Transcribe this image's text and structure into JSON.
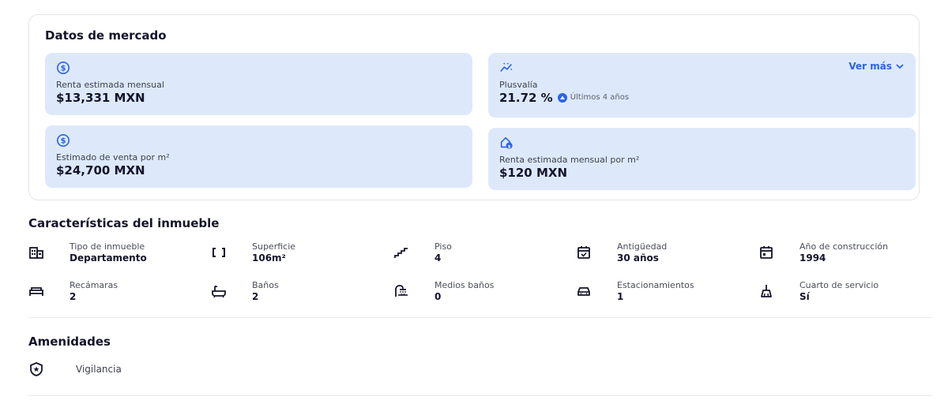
{
  "market": {
    "title": "Datos de mercado",
    "see_more": "Ver más",
    "tiles": [
      {
        "icon": "dollar-circle-icon",
        "label": "Renta estimada mensual",
        "value": "$13,331 MXN"
      },
      {
        "icon": "trend-icon",
        "label": "Plusvalía",
        "value": "21.72 %",
        "note": "Últimos 4 años"
      },
      {
        "icon": "dollar-circle-icon",
        "label": "Estimado de venta por m²",
        "value": "$24,700 MXN"
      },
      {
        "icon": "house-dollar-icon",
        "label": "Renta estimada mensual por m²",
        "value": "$120 MXN"
      }
    ]
  },
  "features": {
    "title": "Características del inmueble",
    "items": [
      {
        "icon": "building-icon",
        "label": "Tipo de inmueble",
        "value": "Departamento"
      },
      {
        "icon": "area-icon",
        "label": "Superficie",
        "value": "106m²"
      },
      {
        "icon": "stairs-icon",
        "label": "Piso",
        "value": "4"
      },
      {
        "icon": "calendar-check-icon",
        "label": "Antigüedad",
        "value": "30 años"
      },
      {
        "icon": "calendar-icon",
        "label": "Año de construcción",
        "value": "1994"
      },
      {
        "icon": "bed-icon",
        "label": "Recámaras",
        "value": "2"
      },
      {
        "icon": "bathtub-icon",
        "label": "Baños",
        "value": "2"
      },
      {
        "icon": "shower-icon",
        "label": "Medios baños",
        "value": "0"
      },
      {
        "icon": "car-icon",
        "label": "Estacionamientos",
        "value": "1"
      },
      {
        "icon": "broom-icon",
        "label": "Cuarto de servicio",
        "value": "Sí"
      }
    ]
  },
  "amenities": {
    "title": "Amenidades",
    "items": [
      {
        "icon": "shield-star-icon",
        "label": "Vigilancia"
      }
    ]
  },
  "colors": {
    "accent": "#2b63e8",
    "tile_bg": "#dde9fb"
  }
}
